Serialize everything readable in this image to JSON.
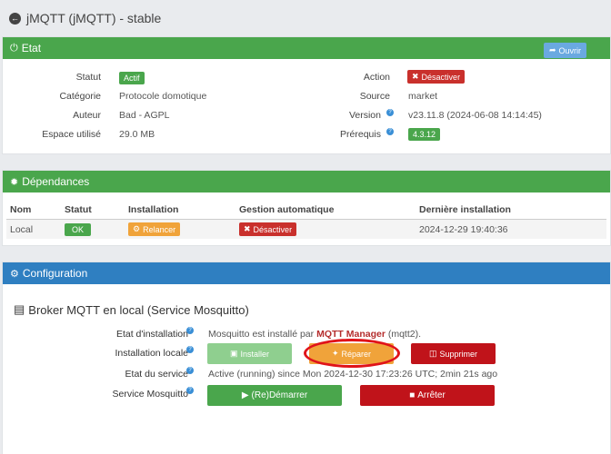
{
  "header": {
    "title": "jMQTT (jMQTT) - stable"
  },
  "etat": {
    "title": "Etat",
    "open_label": "Ouvrir",
    "left": [
      {
        "label": "Statut",
        "value": "Actif"
      },
      {
        "label": "Catégorie",
        "value": "Protocole domotique"
      },
      {
        "label": "Auteur",
        "value": "Bad - AGPL"
      },
      {
        "label": "Espace utilisé",
        "value": "29.0 MB"
      }
    ],
    "right": [
      {
        "label": "Action",
        "value": "Désactiver"
      },
      {
        "label": "Source",
        "value": "market"
      },
      {
        "label": "Version",
        "value": "v23.11.8 (2024-06-08 14:14:45)"
      },
      {
        "label": "Prérequis",
        "value": "4.3.12"
      }
    ]
  },
  "dependances": {
    "title": "Dépendances",
    "columns": [
      "Nom",
      "Statut",
      "Installation",
      "Gestion automatique",
      "Dernière installation"
    ],
    "row": {
      "nom": "Local",
      "statut": "OK",
      "installation": "Relancer",
      "gestion": "Désactiver",
      "derniere": "2024-12-29 19:40:36"
    }
  },
  "configuration": {
    "title": "Configuration",
    "broker_title": "Broker MQTT en local (Service Mosquitto)",
    "etat_install_label": "Etat d'installation",
    "etat_install_prefix": "Mosquitto est installé par",
    "etat_install_link": "MQTT Manager",
    "etat_install_suffix": "(mqtt2).",
    "install_locale_label": "Installation locale",
    "installer": "Installer",
    "reparer": "Réparer",
    "supprimer": "Supprimer",
    "etat_service_label": "Etat du service",
    "etat_service_value": "Active (running) since Mon 2024-12-30 17:23:26 UTC; 2min 21s ago",
    "service_label": "Service Mosquitto",
    "redemarrer": "(Re)Démarrer",
    "arreter": "Arrêter"
  },
  "colors": {
    "green": "#4aa64c",
    "blue": "#2f7fc1",
    "red": "#c9302c",
    "orange": "#f0a33a",
    "circle": "#e0131a"
  }
}
